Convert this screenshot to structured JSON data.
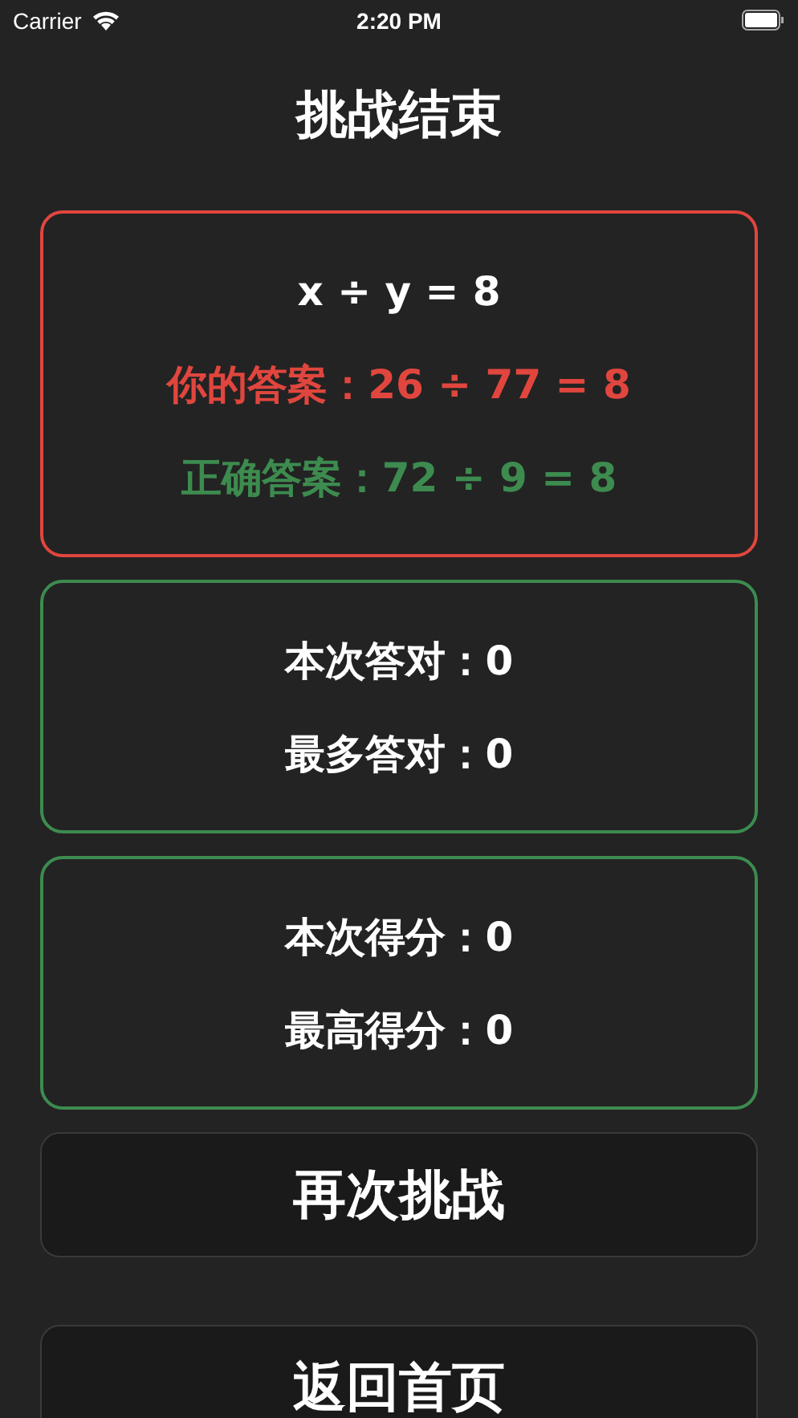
{
  "status_bar": {
    "carrier": "Carrier",
    "time": "2:20 PM"
  },
  "title": "挑战结束",
  "cards": [
    {
      "color": "#e0463e",
      "lines": [
        {
          "text": "x ÷ y = 8",
          "color": "#ffffff"
        },
        {
          "text": "你的答案：26 ÷ 77 = 8",
          "color": "#e0463e"
        },
        {
          "text": "正确答案：72 ÷ 9 = 8",
          "color": "#3d8b4f"
        }
      ]
    },
    {
      "color": "#3d8b4f",
      "lines": [
        {
          "text": "本次答对：0",
          "color": "#ffffff"
        },
        {
          "text": "最多答对：0",
          "color": "#ffffff"
        }
      ]
    },
    {
      "color": "#3d8b4f",
      "lines": [
        {
          "text": "本次得分：0",
          "color": "#ffffff"
        },
        {
          "text": "最高得分：0",
          "color": "#ffffff"
        }
      ]
    }
  ],
  "buttons": [
    "再次挑战",
    "返回首页"
  ]
}
